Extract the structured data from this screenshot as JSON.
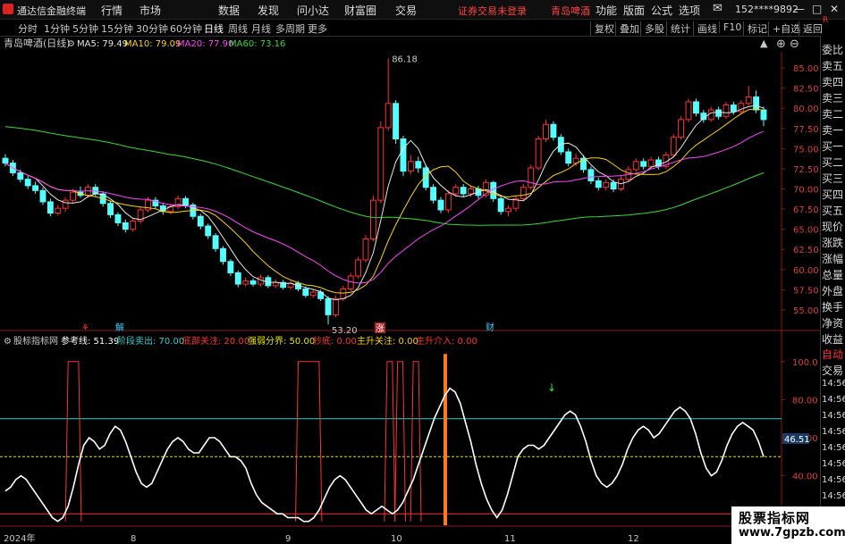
{
  "window": {
    "app_name": "通达信金融终端",
    "menu": [
      "行情",
      "市场",
      "数据",
      "发现",
      "问小达",
      "财富圈",
      "交易"
    ],
    "notice": "证券交易未登录",
    "stock_tag": "青岛啤酒",
    "right_menu": [
      "功能",
      "版面",
      "公式",
      "选项"
    ],
    "user": "152****9892",
    "controls": [
      "—",
      "□",
      "✕"
    ]
  },
  "toolbar": {
    "periods": [
      "分时",
      "1分钟",
      "5分钟",
      "15分钟",
      "30分钟",
      "60分钟",
      "日线",
      "周线",
      "月线",
      "多周期",
      "更多"
    ],
    "active_period": "日线",
    "right_buttons": [
      "复权",
      "叠加",
      "多股",
      "统计",
      "画线",
      "F10",
      "标记",
      "+自选",
      "返回"
    ]
  },
  "main_chart": {
    "title": "青岛啤酒(日线)",
    "ma_labels": [
      {
        "text": "MA5: 79.49",
        "color": "#e6e6e6"
      },
      {
        "text": "MA10: 79.09",
        "color": "#ffd400"
      },
      {
        "text": "MA20: 77.90",
        "color": "#ff44ff"
      },
      {
        "text": "MA60: 73.16",
        "color": "#33dd33"
      }
    ],
    "high_label": "86.18",
    "low_label": "53.20",
    "event_markers": [
      {
        "text": "⚘",
        "color": "#ff3333"
      },
      {
        "text": "解",
        "color": "#33ccff"
      },
      {
        "text": "涨",
        "color": "#ff3333"
      },
      {
        "text": "财",
        "color": "#33ccff"
      }
    ],
    "price_ticks": [
      "85.00",
      "82.50",
      "80.00",
      "77.50",
      "75.00",
      "72.50",
      "70.00",
      "67.50",
      "65.00",
      "62.50",
      "60.00",
      "57.50",
      "55.00"
    ]
  },
  "chart_data": [
    {
      "type": "candlestick",
      "title": "青岛啤酒(日线)",
      "ylim": [
        53,
        87
      ],
      "candles": [
        {
          "o": 73.8,
          "c": 73.2,
          "h": 74.3,
          "l": 72.8
        },
        {
          "o": 73.2,
          "c": 72.0,
          "h": 73.6,
          "l": 71.6
        },
        {
          "o": 72.0,
          "c": 71.2,
          "h": 72.4,
          "l": 70.8
        },
        {
          "o": 71.2,
          "c": 70.4,
          "h": 71.6,
          "l": 70.0
        },
        {
          "o": 70.4,
          "c": 69.8,
          "h": 70.9,
          "l": 69.4
        },
        {
          "o": 69.8,
          "c": 68.4,
          "h": 70.2,
          "l": 68.0
        },
        {
          "o": 68.4,
          "c": 67.0,
          "h": 68.8,
          "l": 66.6
        },
        {
          "o": 67.0,
          "c": 67.6,
          "h": 68.0,
          "l": 66.7
        },
        {
          "o": 67.6,
          "c": 68.6,
          "h": 69.0,
          "l": 67.2
        },
        {
          "o": 68.6,
          "c": 69.6,
          "h": 70.0,
          "l": 68.3
        },
        {
          "o": 69.6,
          "c": 69.2,
          "h": 70.3,
          "l": 68.9
        },
        {
          "o": 69.2,
          "c": 70.2,
          "h": 70.6,
          "l": 68.9
        },
        {
          "o": 70.2,
          "c": 69.4,
          "h": 70.6,
          "l": 69.1
        },
        {
          "o": 69.4,
          "c": 68.2,
          "h": 69.7,
          "l": 67.8
        },
        {
          "o": 68.2,
          "c": 66.8,
          "h": 68.5,
          "l": 66.4
        },
        {
          "o": 66.8,
          "c": 65.8,
          "h": 67.1,
          "l": 65.4
        },
        {
          "o": 65.8,
          "c": 65.0,
          "h": 66.2,
          "l": 64.6
        },
        {
          "o": 65.0,
          "c": 66.0,
          "h": 66.4,
          "l": 64.7
        },
        {
          "o": 66.0,
          "c": 67.4,
          "h": 67.8,
          "l": 65.7
        },
        {
          "o": 67.4,
          "c": 68.6,
          "h": 69.0,
          "l": 67.1
        },
        {
          "o": 68.6,
          "c": 67.9,
          "h": 69.0,
          "l": 67.5
        },
        {
          "o": 67.9,
          "c": 67.2,
          "h": 68.3,
          "l": 66.8
        },
        {
          "o": 67.2,
          "c": 67.8,
          "h": 68.2,
          "l": 66.9
        },
        {
          "o": 67.8,
          "c": 68.8,
          "h": 69.2,
          "l": 67.5
        },
        {
          "o": 68.8,
          "c": 68.0,
          "h": 69.1,
          "l": 67.6
        },
        {
          "o": 68.0,
          "c": 66.6,
          "h": 68.3,
          "l": 66.2
        },
        {
          "o": 66.6,
          "c": 65.4,
          "h": 66.9,
          "l": 65.0
        },
        {
          "o": 65.4,
          "c": 64.2,
          "h": 65.7,
          "l": 63.8
        },
        {
          "o": 64.2,
          "c": 62.6,
          "h": 64.5,
          "l": 62.2
        },
        {
          "o": 62.6,
          "c": 61.0,
          "h": 62.9,
          "l": 60.6
        },
        {
          "o": 61.0,
          "c": 59.6,
          "h": 61.3,
          "l": 59.2
        },
        {
          "o": 59.6,
          "c": 58.2,
          "h": 59.9,
          "l": 57.8
        },
        {
          "o": 58.2,
          "c": 58.6,
          "h": 59.0,
          "l": 57.9
        },
        {
          "o": 58.6,
          "c": 58.2,
          "h": 58.9,
          "l": 57.9
        },
        {
          "o": 58.2,
          "c": 59.0,
          "h": 59.4,
          "l": 57.9
        },
        {
          "o": 59.0,
          "c": 58.0,
          "h": 59.3,
          "l": 57.7
        },
        {
          "o": 58.0,
          "c": 58.4,
          "h": 58.8,
          "l": 57.7
        },
        {
          "o": 58.4,
          "c": 57.8,
          "h": 58.7,
          "l": 57.5
        },
        {
          "o": 57.8,
          "c": 58.3,
          "h": 58.6,
          "l": 57.5
        },
        {
          "o": 58.3,
          "c": 57.6,
          "h": 58.6,
          "l": 57.3
        },
        {
          "o": 57.6,
          "c": 56.8,
          "h": 57.9,
          "l": 56.5
        },
        {
          "o": 56.8,
          "c": 57.2,
          "h": 57.6,
          "l": 56.5
        },
        {
          "o": 57.2,
          "c": 56.4,
          "h": 57.5,
          "l": 56.1
        },
        {
          "o": 56.4,
          "c": 54.4,
          "h": 56.7,
          "l": 53.2
        },
        {
          "o": 54.4,
          "c": 56.4,
          "h": 56.8,
          "l": 54.1
        },
        {
          "o": 56.4,
          "c": 57.6,
          "h": 58.0,
          "l": 56.1
        },
        {
          "o": 57.6,
          "c": 59.2,
          "h": 59.6,
          "l": 57.3
        },
        {
          "o": 59.2,
          "c": 61.2,
          "h": 61.6,
          "l": 58.9
        },
        {
          "o": 61.2,
          "c": 63.8,
          "h": 64.3,
          "l": 60.9
        },
        {
          "o": 63.8,
          "c": 68.6,
          "h": 69.2,
          "l": 63.5
        },
        {
          "o": 68.6,
          "c": 77.6,
          "h": 78.4,
          "l": 68.2
        },
        {
          "o": 77.6,
          "c": 80.6,
          "h": 86.18,
          "l": 77.2
        },
        {
          "o": 80.6,
          "c": 76.2,
          "h": 81.0,
          "l": 75.6
        },
        {
          "o": 76.2,
          "c": 72.2,
          "h": 76.6,
          "l": 71.6
        },
        {
          "o": 72.2,
          "c": 73.4,
          "h": 74.2,
          "l": 71.8
        },
        {
          "o": 73.4,
          "c": 72.6,
          "h": 74.0,
          "l": 72.0
        },
        {
          "o": 72.6,
          "c": 70.2,
          "h": 73.0,
          "l": 69.8
        },
        {
          "o": 70.2,
          "c": 68.6,
          "h": 70.6,
          "l": 68.2
        },
        {
          "o": 68.6,
          "c": 67.4,
          "h": 69.0,
          "l": 67.0
        },
        {
          "o": 67.4,
          "c": 69.4,
          "h": 69.8,
          "l": 67.0
        },
        {
          "o": 69.4,
          "c": 70.2,
          "h": 70.6,
          "l": 69.0
        },
        {
          "o": 70.2,
          "c": 69.4,
          "h": 70.6,
          "l": 69.0
        },
        {
          "o": 69.4,
          "c": 70.0,
          "h": 70.4,
          "l": 69.0
        },
        {
          "o": 70.0,
          "c": 69.2,
          "h": 70.4,
          "l": 68.8
        },
        {
          "o": 69.2,
          "c": 70.8,
          "h": 71.2,
          "l": 68.9
        },
        {
          "o": 70.8,
          "c": 68.8,
          "h": 71.0,
          "l": 68.4
        },
        {
          "o": 68.8,
          "c": 67.2,
          "h": 69.1,
          "l": 66.8
        },
        {
          "o": 67.2,
          "c": 67.6,
          "h": 68.0,
          "l": 66.6
        },
        {
          "o": 67.6,
          "c": 68.8,
          "h": 69.2,
          "l": 67.2
        },
        {
          "o": 68.8,
          "c": 70.2,
          "h": 70.6,
          "l": 68.5
        },
        {
          "o": 70.2,
          "c": 72.6,
          "h": 73.0,
          "l": 69.9
        },
        {
          "o": 72.6,
          "c": 76.2,
          "h": 76.6,
          "l": 72.3
        },
        {
          "o": 76.2,
          "c": 78.0,
          "h": 78.6,
          "l": 75.8
        },
        {
          "o": 78.0,
          "c": 76.4,
          "h": 78.4,
          "l": 76.0
        },
        {
          "o": 76.4,
          "c": 74.6,
          "h": 76.8,
          "l": 74.2
        },
        {
          "o": 74.6,
          "c": 73.2,
          "h": 75.0,
          "l": 72.8
        },
        {
          "o": 73.2,
          "c": 73.8,
          "h": 74.4,
          "l": 72.8
        },
        {
          "o": 73.8,
          "c": 72.4,
          "h": 74.2,
          "l": 72.0
        },
        {
          "o": 72.4,
          "c": 71.0,
          "h": 72.8,
          "l": 70.6
        },
        {
          "o": 71.0,
          "c": 70.2,
          "h": 71.4,
          "l": 69.8
        },
        {
          "o": 70.2,
          "c": 70.8,
          "h": 71.2,
          "l": 69.8
        },
        {
          "o": 70.8,
          "c": 70.0,
          "h": 71.2,
          "l": 69.6
        },
        {
          "o": 70.0,
          "c": 71.2,
          "h": 71.6,
          "l": 69.7
        },
        {
          "o": 71.2,
          "c": 72.4,
          "h": 72.8,
          "l": 70.9
        },
        {
          "o": 72.4,
          "c": 73.4,
          "h": 73.8,
          "l": 72.1
        },
        {
          "o": 73.4,
          "c": 72.8,
          "h": 73.8,
          "l": 72.4
        },
        {
          "o": 72.8,
          "c": 73.6,
          "h": 74.0,
          "l": 72.5
        },
        {
          "o": 73.6,
          "c": 72.8,
          "h": 74.0,
          "l": 72.4
        },
        {
          "o": 72.8,
          "c": 74.2,
          "h": 74.6,
          "l": 72.5
        },
        {
          "o": 74.2,
          "c": 76.4,
          "h": 76.8,
          "l": 73.9
        },
        {
          "o": 76.4,
          "c": 78.6,
          "h": 79.0,
          "l": 76.1
        },
        {
          "o": 78.6,
          "c": 80.8,
          "h": 81.2,
          "l": 78.3
        },
        {
          "o": 80.8,
          "c": 79.4,
          "h": 81.2,
          "l": 79.0
        },
        {
          "o": 79.4,
          "c": 78.6,
          "h": 79.8,
          "l": 78.2
        },
        {
          "o": 78.6,
          "c": 79.8,
          "h": 80.2,
          "l": 78.3
        },
        {
          "o": 79.8,
          "c": 79.0,
          "h": 80.2,
          "l": 78.6
        },
        {
          "o": 79.0,
          "c": 80.4,
          "h": 80.8,
          "l": 78.7
        },
        {
          "o": 80.4,
          "c": 79.6,
          "h": 80.8,
          "l": 79.2
        },
        {
          "o": 79.6,
          "c": 80.6,
          "h": 81.0,
          "l": 79.3
        },
        {
          "o": 80.6,
          "c": 81.4,
          "h": 82.8,
          "l": 80.3
        },
        {
          "o": 81.4,
          "c": 79.8,
          "h": 82.2,
          "l": 79.4
        },
        {
          "o": 79.8,
          "c": 78.6,
          "h": 80.2,
          "l": 77.8
        }
      ],
      "ma_lines": [
        {
          "name": "MA5",
          "color": "#e6e6e6"
        },
        {
          "name": "MA10",
          "color": "#ffd400"
        },
        {
          "name": "MA20",
          "color": "#ff44ff"
        },
        {
          "name": "MA60",
          "color": "#33dd33"
        }
      ]
    },
    {
      "type": "line",
      "title": "股标指标网",
      "ylim": [
        14,
        106
      ],
      "reference_levels": [
        {
          "value": 70,
          "color": "#33cccc"
        },
        {
          "value": 50,
          "color": "#e6e600"
        },
        {
          "value": 20,
          "color": "#ff3333"
        }
      ],
      "series": [
        {
          "name": "参考线",
          "color": "#ffffff",
          "values": [
            32,
            34,
            38,
            40,
            38,
            34,
            30,
            26,
            22,
            18,
            16,
            18,
            24,
            34,
            46,
            56,
            60,
            58,
            54,
            56,
            62,
            66,
            64,
            58,
            50,
            42,
            36,
            34,
            36,
            42,
            48,
            54,
            58,
            60,
            58,
            54,
            52,
            52,
            56,
            60,
            60,
            58,
            54,
            50,
            50,
            48,
            44,
            36,
            30,
            26,
            24,
            22,
            20,
            20,
            18,
            18,
            18,
            16,
            16,
            18,
            22,
            28,
            34,
            38,
            40,
            38,
            34,
            30,
            26,
            22,
            20,
            22,
            24,
            22,
            20,
            22,
            26,
            32,
            38,
            46,
            54,
            62,
            70,
            76,
            82,
            86,
            84,
            78,
            68,
            58,
            46,
            36,
            28,
            22,
            18,
            22,
            30,
            40,
            50,
            54,
            56,
            56,
            54,
            56,
            60,
            64,
            68,
            72,
            74,
            72,
            66,
            58,
            48,
            40,
            36,
            34,
            36,
            40,
            46,
            54,
            60,
            64,
            66,
            64,
            60,
            62,
            66,
            70,
            74,
            76,
            74,
            70,
            62,
            52,
            44,
            40,
            42,
            48,
            56,
            62,
            66,
            68,
            66,
            64,
            58,
            50
          ]
        },
        {
          "name": "主升关注",
          "color": "#ff3333"
        }
      ],
      "pulses": [
        [
          12,
          13,
          14
        ],
        [
          56,
          57,
          58,
          59,
          60
        ],
        [
          73,
          74
        ],
        [
          75,
          76
        ],
        [
          78,
          79
        ]
      ]
    }
  ],
  "indicator": {
    "name": "股标指标网",
    "labels": [
      {
        "text": "参考线: 51.39",
        "color": "#ffffff"
      },
      {
        "text": "阶段卖出: 70.00",
        "color": "#33cccc"
      },
      {
        "text": "底部关注: 20.00",
        "color": "#ff3333"
      },
      {
        "text": "强弱分界: 50.00",
        "color": "#e6e600"
      },
      {
        "text": "抄底: 0.00",
        "color": "#ff3333"
      },
      {
        "text": "主升关注: 0.00",
        "color": "#ffd400"
      },
      {
        "text": "主升介入: 0.00",
        "color": "#ff3333"
      }
    ],
    "ticks": [
      "100.0",
      "80.00",
      "60.00",
      "40.00",
      "20.00"
    ],
    "current_value": "46.51"
  },
  "dates": [
    "2024年",
    "8",
    "9",
    "10",
    "11",
    "12"
  ],
  "right_column": {
    "top": [
      "委比",
      "卖五",
      "卖四",
      "卖三",
      "卖二",
      "卖一",
      "买一",
      "买二",
      "买三",
      "买四",
      "买五",
      "现价",
      "涨跌",
      "涨幅",
      "总量",
      "外盘",
      "换手",
      "净资",
      "收益"
    ],
    "bottom_btn1": "自动",
    "bottom_btn2": "交易",
    "times": [
      "14:56",
      "14:56",
      "14:56",
      "14:56",
      "14:56",
      "14:56",
      "14:56",
      "14:56",
      "14:56"
    ],
    "corner": "R"
  },
  "watermark": {
    "line1": "股票指标网",
    "line2": "www.7gpzb.com"
  }
}
